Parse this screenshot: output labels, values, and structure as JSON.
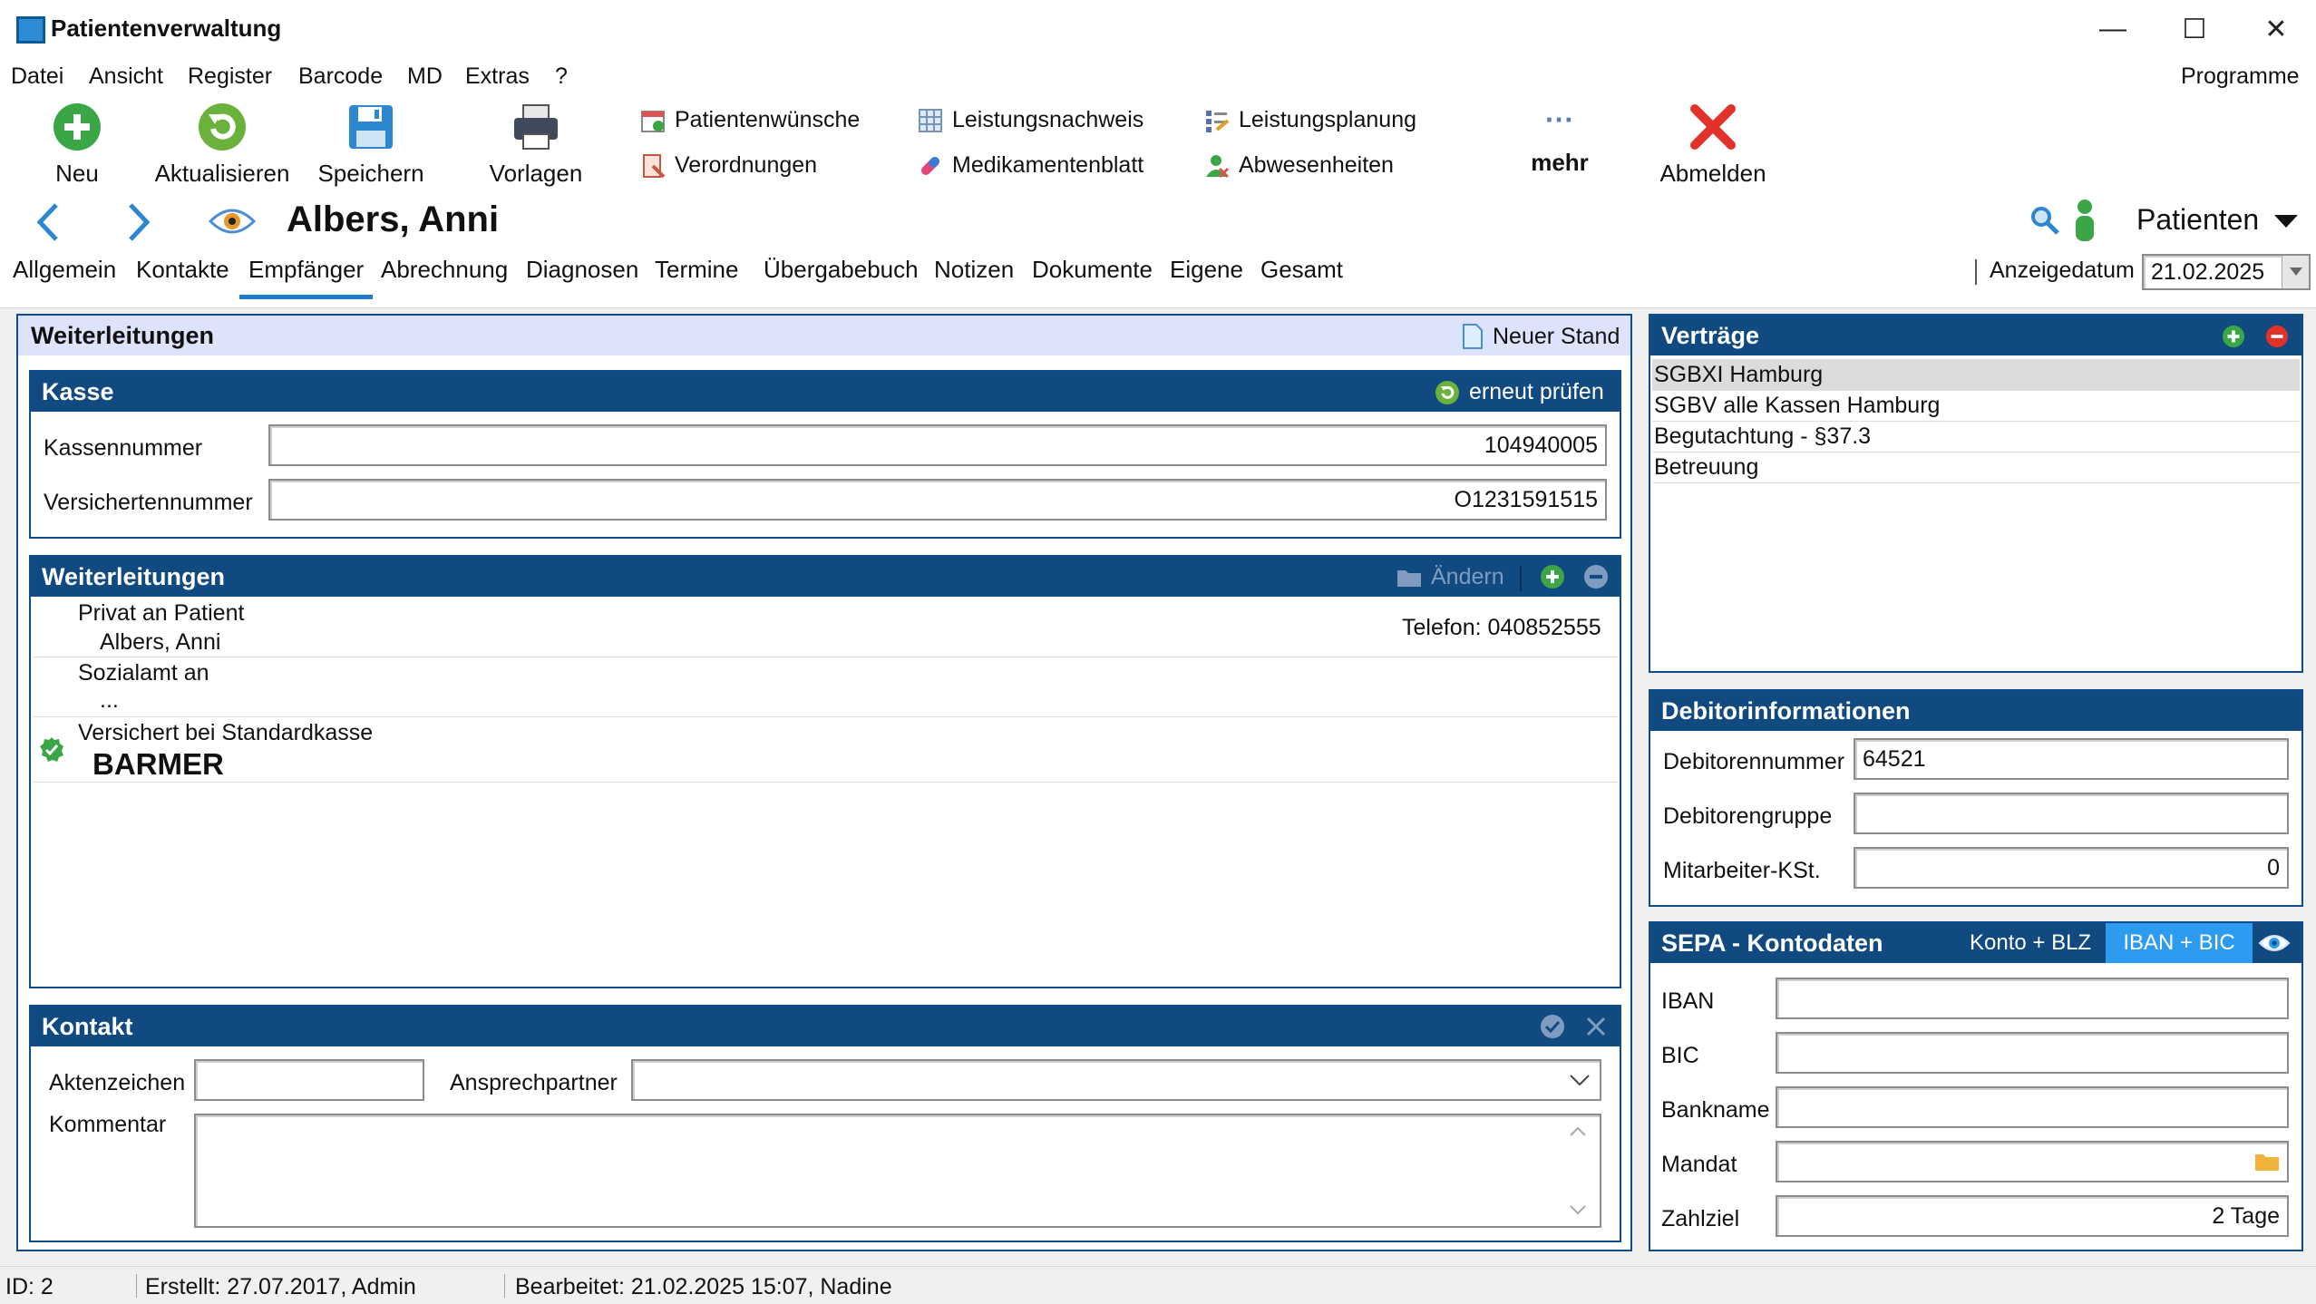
{
  "window": {
    "title": "Patientenverwaltung",
    "minimize": "—",
    "maximize": "☐",
    "close": "✕"
  },
  "menu": {
    "items": [
      "Datei",
      "Ansicht",
      "Register",
      "Barcode",
      "MD",
      "Extras",
      "?"
    ],
    "right": "Programme"
  },
  "toolbar": {
    "neu": "Neu",
    "aktualisieren": "Aktualisieren",
    "speichern": "Speichern",
    "vorlagen": "Vorlagen",
    "patientenwuensche": "Patientenwünsche",
    "verordnungen": "Verordnungen",
    "leistungsnachweis": "Leistungsnachweis",
    "medikamentenblatt": "Medikamentenblatt",
    "leistungsplanung": "Leistungsplanung",
    "abwesenheiten": "Abwesenheiten",
    "mehr_dots": "···",
    "mehr": "mehr",
    "abmelden": "Abmelden"
  },
  "nav": {
    "patient_name": "Albers, Anni",
    "module": "Patienten"
  },
  "tabs": [
    "Allgemein",
    "Kontakte",
    "Empfänger",
    "Abrechnung",
    "Diagnosen",
    "Termine",
    "Übergabebuch",
    "Notizen",
    "Dokumente",
    "Eigene",
    "Gesamt"
  ],
  "active_tab": "Empfänger",
  "anzeige": {
    "label": "Anzeigedatum",
    "value": "21.02.2025"
  },
  "weiterleitungen_outer": {
    "title": "Weiterleitungen",
    "neuer_stand": "Neuer Stand"
  },
  "kasse": {
    "title": "Kasse",
    "erneut": "erneut prüfen",
    "kassennummer_label": "Kassennummer",
    "kassennummer": "104940005",
    "versichertennummer_label": "Versichertennummer",
    "versichertennummer": "O1231591515"
  },
  "weiterleitungen": {
    "title": "Weiterleitungen",
    "aendern": "Ändern",
    "rows": [
      {
        "line1": "Privat an Patient",
        "line2": "Albers, Anni",
        "phone": "Telefon: 040852555"
      },
      {
        "line1": "Sozialamt an",
        "line2": "..."
      },
      {
        "line1": "Versichert bei Standardkasse",
        "line2": "BARMER"
      }
    ]
  },
  "kontakt": {
    "title": "Kontakt",
    "aktenzeichen": "Aktenzeichen",
    "ansprechpartner": "Ansprechpartner",
    "kommentar": "Kommentar"
  },
  "vertraege": {
    "title": "Verträge",
    "items": [
      "SGBXI Hamburg",
      "SGBV alle Kassen Hamburg",
      "Begutachtung - §37.3",
      "Betreuung"
    ]
  },
  "debitor": {
    "title": "Debitorinformationen",
    "nummer_label": "Debitorennummer",
    "nummer": "64521",
    "gruppe_label": "Debitorengruppe",
    "gruppe": "",
    "kst_label": "Mitarbeiter-KSt.",
    "kst": "0"
  },
  "sepa": {
    "title": "SEPA - Kontodaten",
    "konto_blz": "Konto + BLZ",
    "iban_bic": "IBAN + BIC",
    "iban_label": "IBAN",
    "bic_label": "BIC",
    "bankname_label": "Bankname",
    "mandat_label": "Mandat",
    "zahlziel_label": "Zahlziel",
    "zahlziel": "2 Tage"
  },
  "status": {
    "id": "ID: 2",
    "erstellt": "Erstellt: 27.07.2017, Admin",
    "bearbeitet": "Bearbeitet: 21.02.2025 15:07, Nadine"
  },
  "colors": {
    "header": "#114a80",
    "accent": "#1e7bd2",
    "active_toggle": "#2d9bf0"
  }
}
